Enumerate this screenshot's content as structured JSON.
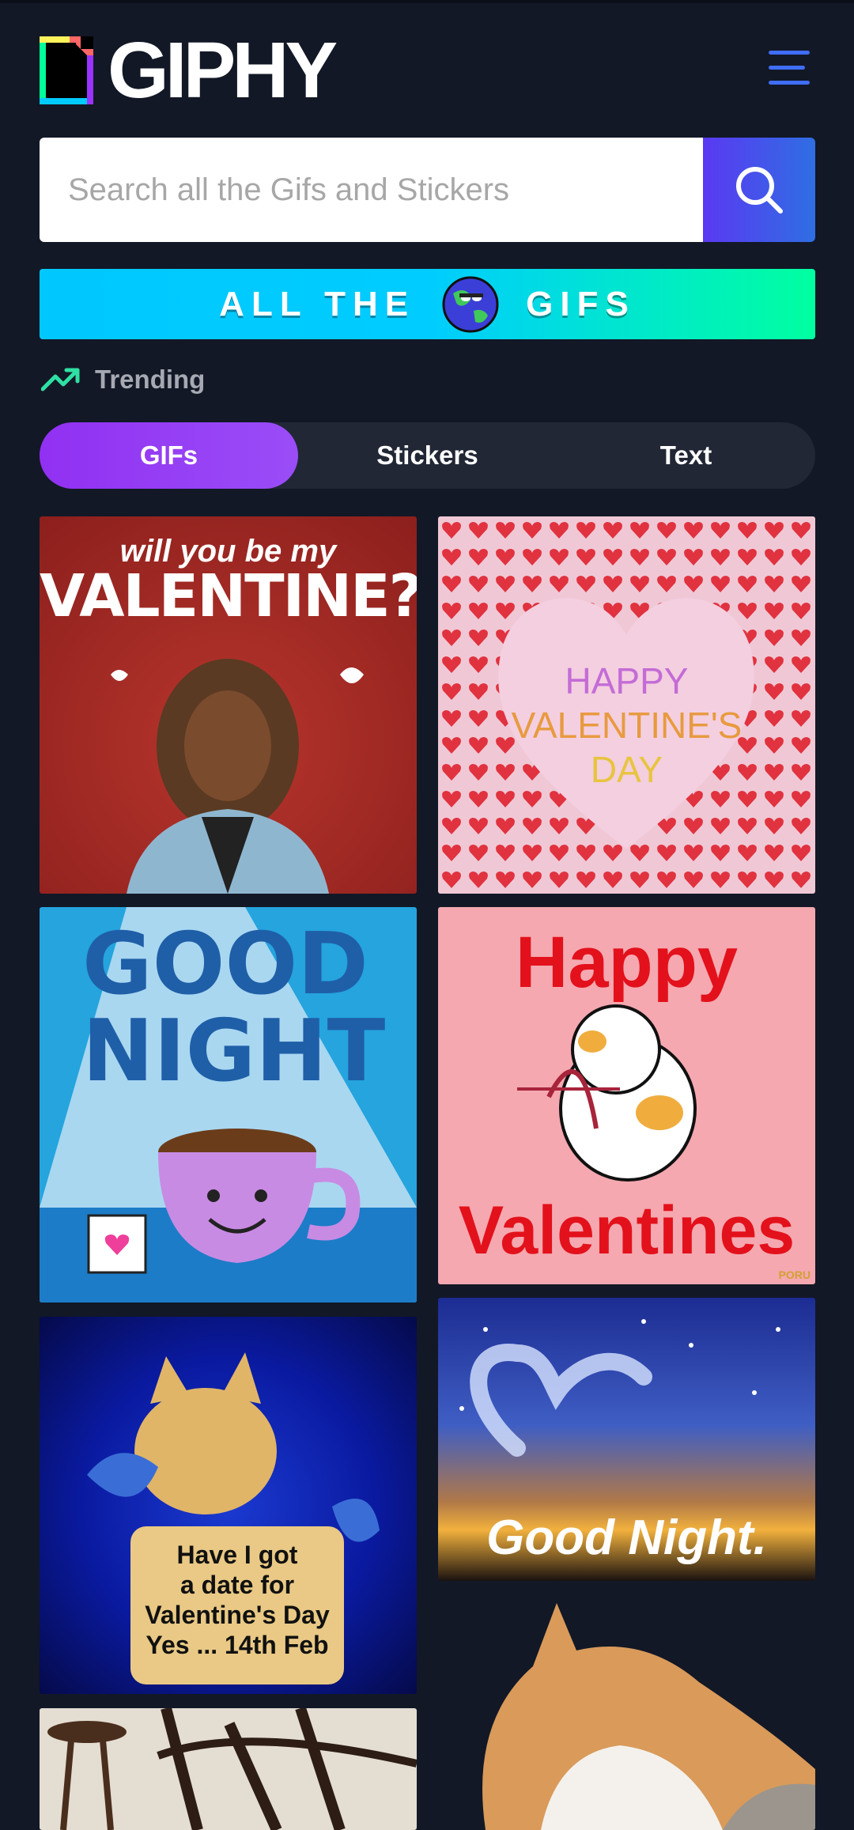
{
  "header": {
    "logo_text": "GIPHY",
    "menu_icon": "hamburger-menu-icon"
  },
  "search": {
    "placeholder": "Search all the Gifs and Stickers",
    "icon": "search-icon"
  },
  "banner": {
    "left_text": "ALL THE",
    "right_text": "GIFS",
    "icon": "globe-icon"
  },
  "trending": {
    "label": "Trending",
    "icon": "trending-up-icon"
  },
  "tabs": [
    {
      "label": "GIFs",
      "active": true
    },
    {
      "label": "Stickers",
      "active": false
    },
    {
      "label": "Text",
      "active": false
    }
  ],
  "gifs": [
    {
      "caption_top": "will you be my",
      "caption_main": "VALENTINE?"
    },
    {
      "caption_lines": [
        "HAPPY",
        "VALENTINE'S",
        "DAY"
      ]
    },
    {
      "caption_lines": [
        "GOOD",
        "NIGHT"
      ]
    },
    {
      "caption_top": "Happy",
      "caption_bottom": "Valentines",
      "credit": "PORU"
    },
    {
      "caption_lines": [
        "Have I got",
        "a date for",
        "Valentine's Day",
        "Yes ... 14th Feb"
      ]
    },
    {
      "caption_main": "Good Night."
    },
    {
      "caption_main": ""
    },
    {
      "caption_main": ""
    }
  ],
  "colors": {
    "background": "#121826",
    "accent_purple": "#9130f2",
    "search_blue": "#2f6ee3",
    "banner_cyan": "#00ccff",
    "banner_green": "#00ffa0"
  }
}
